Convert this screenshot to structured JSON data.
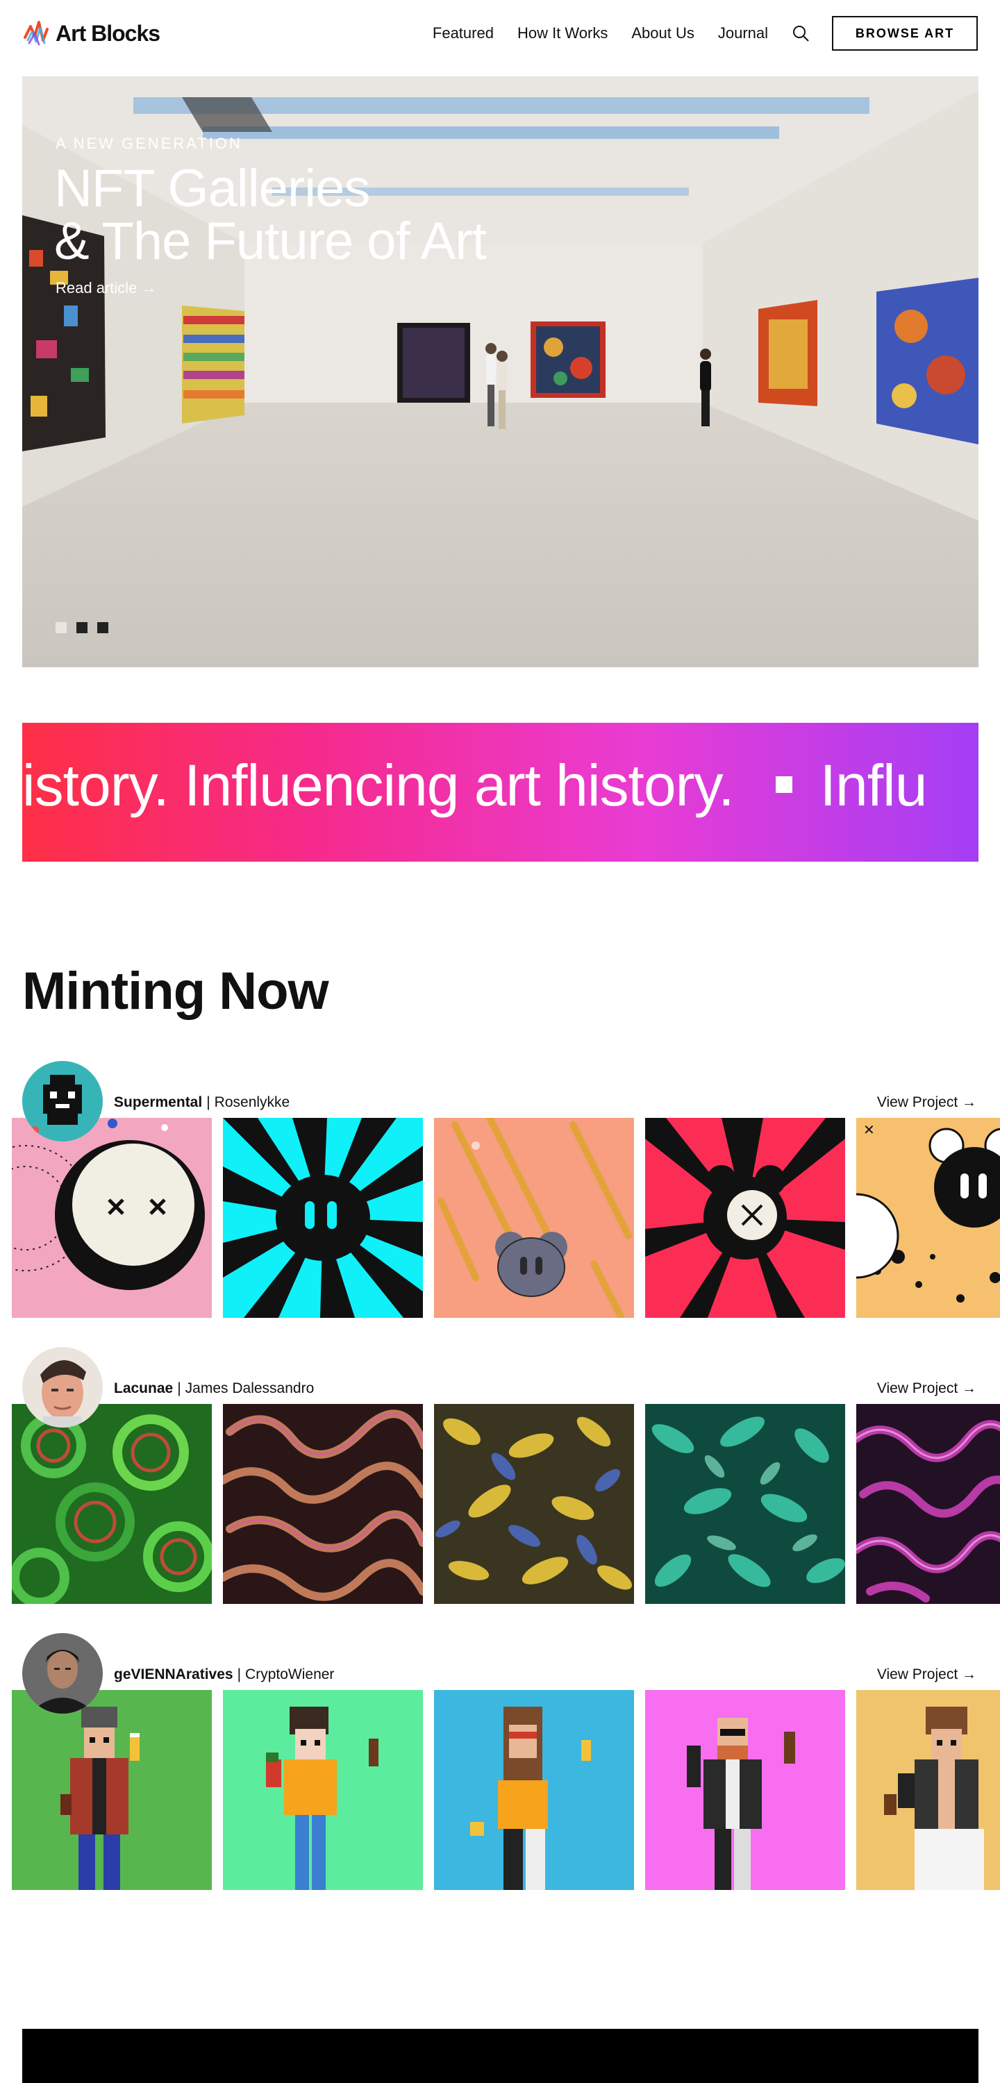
{
  "header": {
    "logo_text": "Art Blocks",
    "nav": [
      "Featured",
      "How It Works",
      "About Us",
      "Journal"
    ],
    "search_icon": "search-icon",
    "browse_label": "BROWSE ART"
  },
  "hero": {
    "kicker": "A NEW GENERATION",
    "title_line1": "NFT Galleries",
    "title_line2": "& The Future of Art",
    "link": "Read article →",
    "slide_count": 3,
    "active_slide": 1
  },
  "banner": {
    "text_a": "istory. Influencing art history.",
    "text_b": "Influ",
    "gradient": [
      "#fe2f45",
      "#e93cd4",
      "#a43ef5"
    ]
  },
  "minting": {
    "title": "Minting Now",
    "view_label": "View Project →",
    "projects": [
      {
        "name": "Supermental",
        "artist": "Rosenlykke"
      },
      {
        "name": "Lacunae",
        "artist": "James Dalessandro"
      },
      {
        "name": "geVIENNAratives",
        "artist": "CryptoWiener"
      }
    ]
  }
}
